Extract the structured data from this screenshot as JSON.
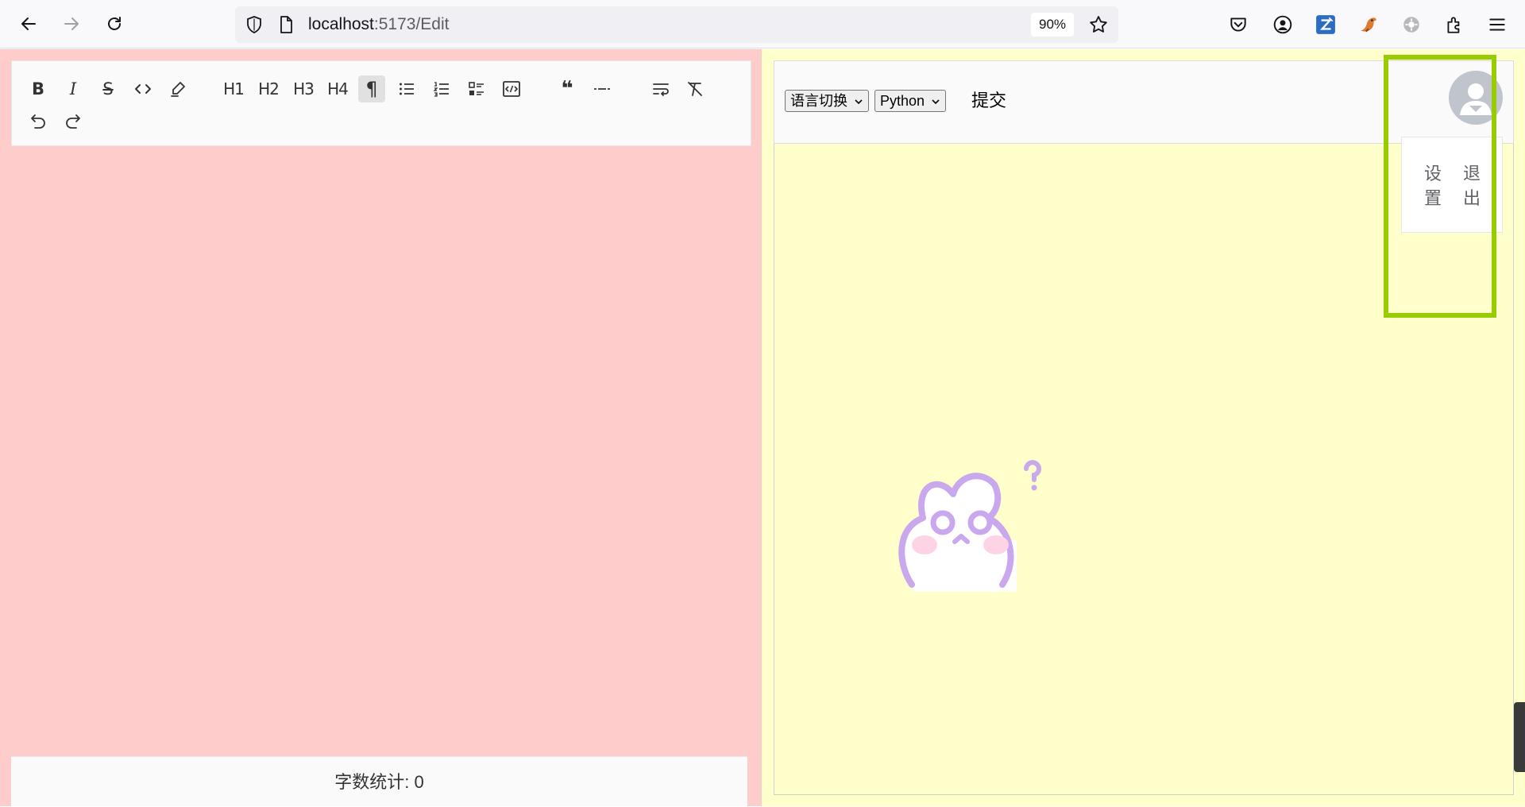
{
  "browser": {
    "url_host": "localhost",
    "url_path": ":5173/Edit",
    "zoom": "90%",
    "toolbar_icons": [
      "pocket-icon",
      "account-icon",
      "zotero-icon",
      "bird-extension-icon",
      "extension-gear-icon",
      "extensions-icon",
      "menu-icon"
    ]
  },
  "editor": {
    "toolbar_buttons": [
      {
        "name": "bold",
        "label": "B"
      },
      {
        "name": "italic",
        "label": "I"
      },
      {
        "name": "strikethrough",
        "label": "S"
      },
      {
        "name": "inline-code",
        "label": "‹›"
      },
      {
        "name": "highlight",
        "label": ""
      },
      {
        "name": "heading-1",
        "label": "H1"
      },
      {
        "name": "heading-2",
        "label": "H2"
      },
      {
        "name": "heading-3",
        "label": "H3"
      },
      {
        "name": "heading-4",
        "label": "H4"
      },
      {
        "name": "paragraph",
        "label": "¶",
        "active": true
      },
      {
        "name": "bullet-list",
        "label": ""
      },
      {
        "name": "ordered-list",
        "label": ""
      },
      {
        "name": "task-list",
        "label": ""
      },
      {
        "name": "code-block",
        "label": ""
      },
      {
        "name": "blockquote",
        "label": "❝"
      },
      {
        "name": "horizontal-rule",
        "label": ""
      },
      {
        "name": "hard-break",
        "label": ""
      },
      {
        "name": "clear-format",
        "label": ""
      },
      {
        "name": "undo",
        "label": ""
      },
      {
        "name": "redo",
        "label": ""
      }
    ],
    "word_count_label": "字数统计: 0",
    "background_color": "#ffcccc"
  },
  "right_panel": {
    "language_select": "语言切换",
    "code_language_select": "Python",
    "submit_label": "提交",
    "user_menu": {
      "items": [
        "设置",
        "退出"
      ]
    },
    "background_color": "#ffffcc",
    "highlight_color": "#99cc00"
  }
}
